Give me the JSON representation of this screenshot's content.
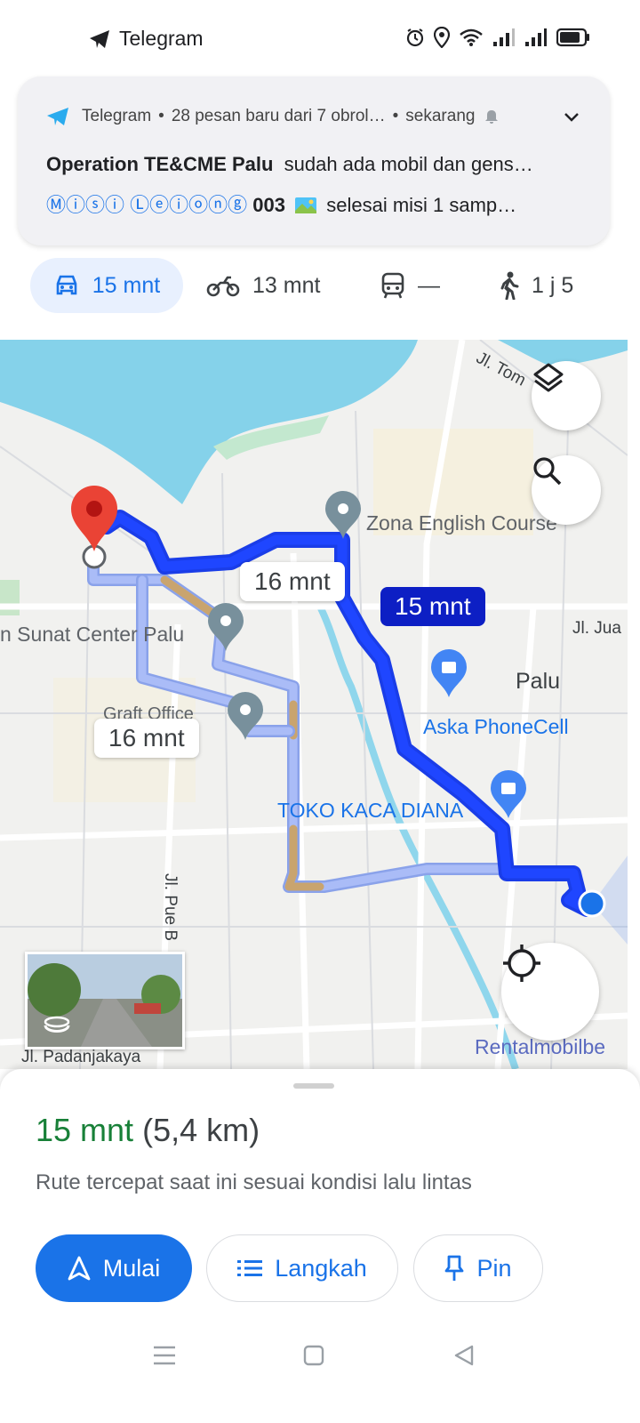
{
  "status_bar": {
    "app_label": "Telegram",
    "icons": [
      "telegram-icon",
      "alarm-icon",
      "location-icon",
      "wifi-icon",
      "signal-icon",
      "signal-icon",
      "battery-icon"
    ]
  },
  "notification": {
    "app": "Telegram",
    "summary": "28 pesan baru dari 7 obrol…",
    "time": "sekarang",
    "line1_title": "Operation TE&CME Palu",
    "line1_text": "sudah ada mobil dan gens…",
    "line2_title": "Ⓜⓘⓢⓘ Ⓛⓔⓘⓞⓝⓖ",
    "line2_num": "003",
    "line2_text": "selesai misi 1 samp…",
    "bullet": "•"
  },
  "travel_modes": [
    {
      "mode": "car",
      "label": "15 mnt",
      "selected": true
    },
    {
      "mode": "motorcycle",
      "label": "13 mnt"
    },
    {
      "mode": "transit",
      "label": "—"
    },
    {
      "mode": "walk",
      "label": "1 j 5"
    }
  ],
  "map": {
    "route_labels": {
      "primary": "15 mnt",
      "alt1": "16 mnt",
      "alt2": "16 mnt"
    },
    "places": {
      "zona": "Zona English Course",
      "sunat": "n Sunat Center Palu",
      "palu": "Palu",
      "aska": "Aska PhoneCell",
      "toko": "TOKO KACA DIANA",
      "office": "Graft Office",
      "rental": "Rentalmobilbe"
    },
    "streets": {
      "tom": "Jl. Tom",
      "jua": "Jl. Jua",
      "pue": "Jl. Pue B",
      "padanjakaya": "Jl. Padanjakaya"
    },
    "colors": {
      "primary_route": "#1a3de8",
      "alt_route": "#aabcf7",
      "traffic_route": "#c9a46e",
      "water": "#85d2ea"
    }
  },
  "sheet": {
    "duration": "15 mnt",
    "distance": "(5,4 km)",
    "subtitle": "Rute tercepat saat ini sesuai kondisi lalu lintas",
    "buttons": {
      "start": "Mulai",
      "steps": "Langkah",
      "pin": "Pin"
    }
  },
  "colors": {
    "accent": "#1a73e8",
    "duration_green": "#188038"
  }
}
